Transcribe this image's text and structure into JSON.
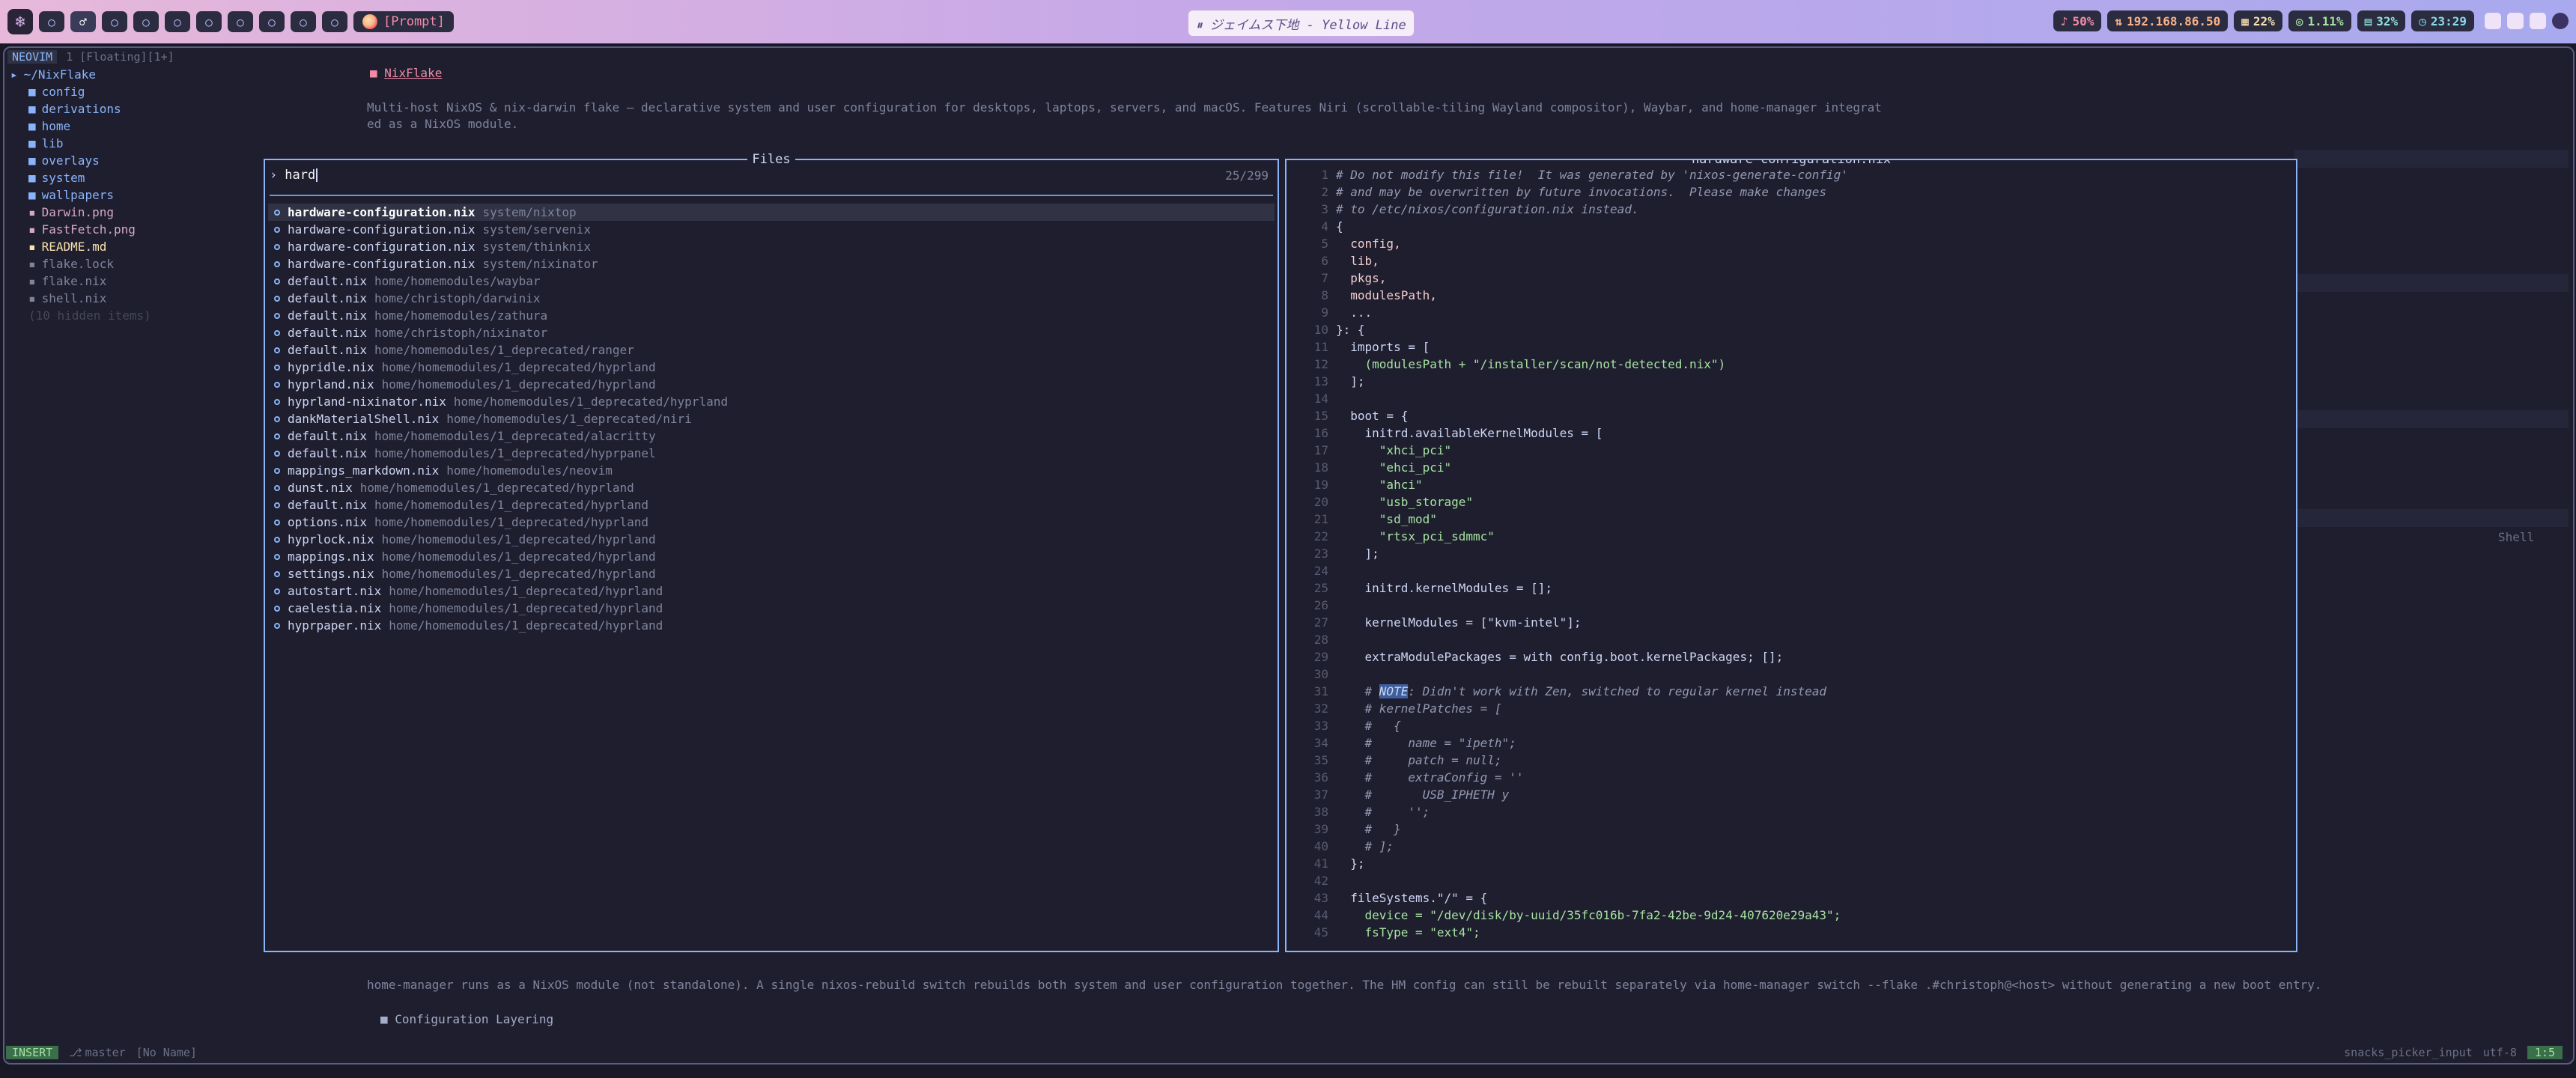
{
  "topbar": {
    "workspaces": [
      "○",
      "○",
      "○",
      "○",
      "○",
      "○",
      "○",
      "○",
      "○",
      "○"
    ],
    "active_workspace_glyph": "♂",
    "prompt_label": "[Prompt]",
    "media_title": "⏸ ジェイムス下地 - Yellow Line",
    "stats": [
      {
        "label": "50%",
        "color": "#f38ba8"
      },
      {
        "label": "192.168.86.50",
        "color": "#fab387"
      },
      {
        "label": "22%",
        "color": "#f9e2af"
      },
      {
        "label": "1.11%",
        "color": "#a6e3a1"
      },
      {
        "label": "32%",
        "color": "#94e2d5"
      },
      {
        "label": "23:29",
        "color": "#89dceb"
      }
    ]
  },
  "editor": {
    "tabline": {
      "neovim": "NEOVIM",
      "tab": "1 [Floating][1+]"
    },
    "tree": {
      "root": "~/NixFlake",
      "items": [
        {
          "name": "config",
          "kind": "dir"
        },
        {
          "name": "derivations",
          "kind": "dir"
        },
        {
          "name": "home",
          "kind": "dir"
        },
        {
          "name": "lib",
          "kind": "dir"
        },
        {
          "name": "overlays",
          "kind": "dir"
        },
        {
          "name": "system",
          "kind": "dir"
        },
        {
          "name": "wallpapers",
          "kind": "dir"
        },
        {
          "name": "Darwin.png",
          "kind": "file"
        },
        {
          "name": "FastFetch.png",
          "kind": "file"
        },
        {
          "name": "README.md",
          "kind": "file"
        },
        {
          "name": "flake.lock",
          "kind": "file"
        },
        {
          "name": "flake.nix",
          "kind": "file"
        },
        {
          "name": "shell.nix",
          "kind": "file"
        },
        {
          "name": "(10 hidden items)",
          "kind": "hidden"
        }
      ]
    },
    "background": {
      "heading": "NixFlake",
      "description_1": "Multi-host NixOS & nix-darwin flake — declarative system and user configuration for desktops, laptops, servers, and macOS. Features Niri (scrollable-tiling Wayland compositor), Waybar, and home-manager integrat",
      "description_2": "ed as a NixOS module.",
      "shell_label": "Shell",
      "bottom_line": "home-manager runs as a NixOS module (not standalone). A single  nixos-rebuild switch  rebuilds both system and user configuration together. The HM config can still be rebuilt separately via  home-manager switch --flake .#christoph@<host>  without generating a new boot entry.",
      "bottom_heading": "Configuration Layering"
    },
    "statusline": {
      "mode": "INSERT",
      "branch": "master",
      "buffer": "[No Name]",
      "filetype": "snacks_picker_input",
      "encoding": "utf-8",
      "position": "1:5"
    }
  },
  "picker": {
    "title": "Files",
    "query": "hard",
    "count": "25/299",
    "results": [
      {
        "name": "hardware-configuration.nix",
        "path": "system/nixtop"
      },
      {
        "name": "hardware-configuration.nix",
        "path": "system/servenix"
      },
      {
        "name": "hardware-configuration.nix",
        "path": "system/thinknix"
      },
      {
        "name": "hardware-configuration.nix",
        "path": "system/nixinator"
      },
      {
        "name": "default.nix",
        "path": "home/homemodules/waybar"
      },
      {
        "name": "default.nix",
        "path": "home/christoph/darwinix"
      },
      {
        "name": "default.nix",
        "path": "home/homemodules/zathura"
      },
      {
        "name": "default.nix",
        "path": "home/christoph/nixinator"
      },
      {
        "name": "default.nix",
        "path": "home/homemodules/1_deprecated/ranger"
      },
      {
        "name": "hypridle.nix",
        "path": "home/homemodules/1_deprecated/hyprland"
      },
      {
        "name": "hyprland.nix",
        "path": "home/homemodules/1_deprecated/hyprland"
      },
      {
        "name": "hyprland-nixinator.nix",
        "path": "home/homemodules/1_deprecated/hyprland"
      },
      {
        "name": "dankMaterialShell.nix",
        "path": "home/homemodules/1_deprecated/niri"
      },
      {
        "name": "default.nix",
        "path": "home/homemodules/1_deprecated/alacritty"
      },
      {
        "name": "default.nix",
        "path": "home/homemodules/1_deprecated/hyprpanel"
      },
      {
        "name": "mappings_markdown.nix",
        "path": "home/homemodules/neovim"
      },
      {
        "name": "dunst.nix",
        "path": "home/homemodules/1_deprecated/hyprland"
      },
      {
        "name": "default.nix",
        "path": "home/homemodules/1_deprecated/hyprland"
      },
      {
        "name": "options.nix",
        "path": "home/homemodules/1_deprecated/hyprland"
      },
      {
        "name": "hyprlock.nix",
        "path": "home/homemodules/1_deprecated/hyprland"
      },
      {
        "name": "mappings.nix",
        "path": "home/homemodules/1_deprecated/hyprland"
      },
      {
        "name": "settings.nix",
        "path": "home/homemodules/1_deprecated/hyprland"
      },
      {
        "name": "autostart.nix",
        "path": "home/homemodules/1_deprecated/hyprland"
      },
      {
        "name": "caelestia.nix",
        "path": "home/homemodules/1_deprecated/hyprland"
      },
      {
        "name": "hyprpaper.nix",
        "path": "home/homemodules/1_deprecated/hyprland"
      }
    ]
  },
  "preview": {
    "title": "hardware-configuration.nix",
    "lines": [
      {
        "n": "1",
        "t": "# Do not modify this file!  It was generated by 'nixos-generate-config'",
        "k": "comment"
      },
      {
        "n": "2",
        "t": "# and may be overwritten by future invocations.  Please make changes",
        "k": "comment"
      },
      {
        "n": "3",
        "t": "# to /etc/nixos/configuration.nix instead.",
        "k": "comment"
      },
      {
        "n": "4",
        "t": "{",
        "k": "plain"
      },
      {
        "n": "5",
        "t": "  config,",
        "k": "ident"
      },
      {
        "n": "6",
        "t": "  lib,",
        "k": "ident"
      },
      {
        "n": "7",
        "t": "  pkgs,",
        "k": "ident"
      },
      {
        "n": "8",
        "t": "  modulesPath,",
        "k": "ident"
      },
      {
        "n": "9",
        "t": "  ...",
        "k": "plain"
      },
      {
        "n": "10",
        "t": "}: {",
        "k": "plain"
      },
      {
        "n": "11",
        "t": "  imports = [",
        "k": "plain"
      },
      {
        "n": "12",
        "t": "    (modulesPath + \"/installer/scan/not-detected.nix\")",
        "k": "str"
      },
      {
        "n": "13",
        "t": "  ];",
        "k": "plain"
      },
      {
        "n": "14",
        "t": "",
        "k": "plain"
      },
      {
        "n": "15",
        "t": "  boot = {",
        "k": "plain"
      },
      {
        "n": "16",
        "t": "    initrd.availableKernelModules = [",
        "k": "plain"
      },
      {
        "n": "17",
        "t": "      \"xhci_pci\"",
        "k": "str"
      },
      {
        "n": "18",
        "t": "      \"ehci_pci\"",
        "k": "str"
      },
      {
        "n": "19",
        "t": "      \"ahci\"",
        "k": "str"
      },
      {
        "n": "20",
        "t": "      \"usb_storage\"",
        "k": "str"
      },
      {
        "n": "21",
        "t": "      \"sd_mod\"",
        "k": "str"
      },
      {
        "n": "22",
        "t": "      \"rtsx_pci_sdmmc\"",
        "k": "str"
      },
      {
        "n": "23",
        "t": "    ];",
        "k": "plain"
      },
      {
        "n": "24",
        "t": "",
        "k": "plain"
      },
      {
        "n": "25",
        "t": "    initrd.kernelModules = [];",
        "k": "plain"
      },
      {
        "n": "26",
        "t": "",
        "k": "plain"
      },
      {
        "n": "27",
        "t": "    kernelModules = [\"kvm-intel\"];",
        "k": "plain"
      },
      {
        "n": "28",
        "t": "",
        "k": "plain"
      },
      {
        "n": "29",
        "t": "    extraModulePackages = with config.boot.kernelPackages; [];",
        "k": "plain"
      },
      {
        "n": "30",
        "t": "",
        "k": "plain"
      },
      {
        "n": "31",
        "t": "    # NOTE: Didn't work with Zen, switched to regular kernel instead",
        "k": "note"
      },
      {
        "n": "32",
        "t": "    # kernelPatches = [",
        "k": "comment"
      },
      {
        "n": "33",
        "t": "    #   {",
        "k": "comment"
      },
      {
        "n": "34",
        "t": "    #     name = \"ipeth\";",
        "k": "comment"
      },
      {
        "n": "35",
        "t": "    #     patch = null;",
        "k": "comment"
      },
      {
        "n": "36",
        "t": "    #     extraConfig = ''",
        "k": "comment"
      },
      {
        "n": "37",
        "t": "    #       USB_IPHETH y",
        "k": "comment"
      },
      {
        "n": "38",
        "t": "    #     '';",
        "k": "comment"
      },
      {
        "n": "39",
        "t": "    #   }",
        "k": "comment"
      },
      {
        "n": "40",
        "t": "    # ];",
        "k": "comment"
      },
      {
        "n": "41",
        "t": "  };",
        "k": "plain"
      },
      {
        "n": "42",
        "t": "",
        "k": "plain"
      },
      {
        "n": "43",
        "t": "  fileSystems.\"/\" = {",
        "k": "plain"
      },
      {
        "n": "44",
        "t": "    device = \"/dev/disk/by-uuid/35fc016b-7fa2-42be-9d24-407620e29a43\";",
        "k": "str"
      },
      {
        "n": "45",
        "t": "    fsType = \"ext4\";",
        "k": "str"
      }
    ]
  }
}
